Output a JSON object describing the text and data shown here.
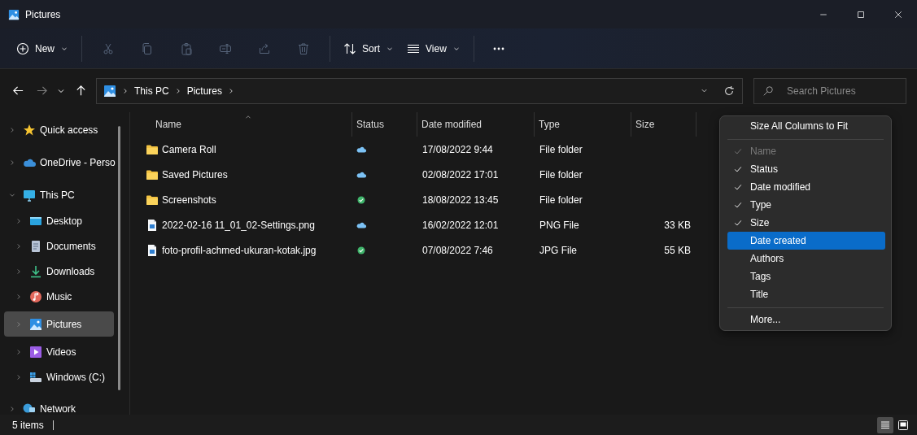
{
  "window": {
    "title": "Pictures"
  },
  "toolbar": {
    "items": [
      {
        "kind": "new",
        "label": "New",
        "disabled": false
      },
      {
        "kind": "cut",
        "disabled": true
      },
      {
        "kind": "copy",
        "disabled": true
      },
      {
        "kind": "paste",
        "disabled": true
      },
      {
        "kind": "rename",
        "disabled": true
      },
      {
        "kind": "share",
        "disabled": true
      },
      {
        "kind": "delete",
        "disabled": true
      },
      {
        "kind": "sort",
        "label": "Sort",
        "disabled": false
      },
      {
        "kind": "view",
        "label": "View",
        "disabled": false
      },
      {
        "kind": "more",
        "disabled": false
      }
    ]
  },
  "navigation": [
    {
      "kind": "back",
      "disabled": false
    },
    {
      "kind": "forward",
      "disabled": true
    },
    {
      "kind": "recent",
      "disabled": false
    },
    {
      "kind": "up",
      "disabled": false
    }
  ],
  "address": {
    "breadcrumb": [
      "This PC",
      "Pictures"
    ]
  },
  "search": {
    "placeholder": "Search Pictures"
  },
  "sidebar": {
    "items": [
      {
        "label": "Quick access",
        "kind": "star",
        "expanded": false,
        "selected": false
      },
      {
        "label": "OneDrive - Perso",
        "kind": "cloud",
        "expanded": false,
        "selected": false
      },
      {
        "label": "This PC",
        "kind": "computer",
        "expanded": true,
        "selected": false,
        "children": [
          {
            "label": "Desktop",
            "kind": "desktop",
            "expanded": false,
            "selected": false
          },
          {
            "label": "Documents",
            "kind": "documents",
            "expanded": false,
            "selected": false
          },
          {
            "label": "Downloads",
            "kind": "downloads",
            "expanded": false,
            "selected": false
          },
          {
            "label": "Music",
            "kind": "music",
            "expanded": false,
            "selected": false
          },
          {
            "label": "Pictures",
            "kind": "pictures",
            "expanded": false,
            "selected": true
          },
          {
            "label": "Videos",
            "kind": "videos",
            "expanded": false,
            "selected": false
          },
          {
            "label": "Windows (C:)",
            "kind": "drive",
            "expanded": false,
            "selected": false
          }
        ]
      },
      {
        "label": "Network",
        "kind": "network",
        "expanded": false,
        "selected": false
      }
    ]
  },
  "table": {
    "columns": [
      {
        "label": "Name",
        "sorted": true
      },
      {
        "label": "Status",
        "sorted": false
      },
      {
        "label": "Date modified",
        "sorted": false
      },
      {
        "label": "Type",
        "sorted": false
      },
      {
        "label": "Size",
        "sorted": false
      }
    ],
    "rows": [
      {
        "kind": "folder",
        "name": "Camera Roll",
        "synced": false,
        "date_modified": "17/08/2022 9:44",
        "type": "File folder"
      },
      {
        "kind": "folder",
        "name": "Saved Pictures",
        "synced": false,
        "date_modified": "02/08/2022 17:01",
        "type": "File folder"
      },
      {
        "kind": "folder",
        "name": "Screenshots",
        "synced": true,
        "date_modified": "18/08/2022 13:45",
        "type": "File folder"
      },
      {
        "kind": "image",
        "name": "2022-02-16 11_01_02-Settings.png",
        "synced": false,
        "date_modified": "16/02/2022 12:01",
        "type": "PNG File",
        "size": "33 KB"
      },
      {
        "kind": "image",
        "name": "foto-profil-achmed-ukuran-kotak.jpg",
        "synced": true,
        "date_modified": "07/08/2022 7:46",
        "type": "JPG File",
        "size": "55 KB"
      }
    ]
  },
  "context_menu": {
    "items": [
      {
        "kind": "action",
        "label": "Size All Columns to Fit",
        "selected": false
      },
      {
        "kind": "separator"
      },
      {
        "kind": "toggle",
        "label": "Name",
        "checked": true,
        "disabled": true,
        "selected": false
      },
      {
        "kind": "toggle",
        "label": "Status",
        "checked": true,
        "disabled": false,
        "selected": false
      },
      {
        "kind": "toggle",
        "label": "Date modified",
        "checked": true,
        "disabled": false,
        "selected": false
      },
      {
        "kind": "toggle",
        "label": "Type",
        "checked": true,
        "disabled": false,
        "selected": false
      },
      {
        "kind": "toggle",
        "label": "Size",
        "checked": true,
        "disabled": false,
        "selected": false
      },
      {
        "kind": "toggle",
        "label": "Date created",
        "checked": false,
        "disabled": false,
        "selected": true
      },
      {
        "kind": "toggle",
        "label": "Authors",
        "checked": false,
        "disabled": false,
        "selected": false
      },
      {
        "kind": "toggle",
        "label": "Tags",
        "checked": false,
        "disabled": false,
        "selected": false
      },
      {
        "kind": "toggle",
        "label": "Title",
        "checked": false,
        "disabled": false,
        "selected": false
      },
      {
        "kind": "separator"
      },
      {
        "kind": "action",
        "label": "More...",
        "selected": false
      }
    ]
  },
  "status_bar": {
    "item_count": "5 items",
    "views": [
      {
        "kind": "details",
        "selected": true
      },
      {
        "kind": "tiles",
        "selected": false
      }
    ]
  }
}
